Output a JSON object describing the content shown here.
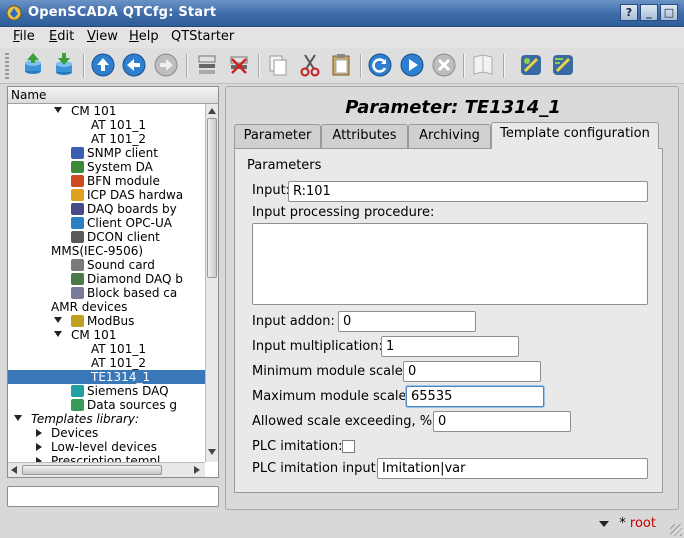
{
  "window": {
    "title": "OpenSCADA QTCfg: Start",
    "controls": [
      "?",
      "_",
      "□",
      "✕"
    ]
  },
  "menu": {
    "items": [
      {
        "label": "File",
        "mnemonic": "F",
        "rest": "ile"
      },
      {
        "label": "Edit",
        "mnemonic": "E",
        "rest": "dit"
      },
      {
        "label": "View",
        "mnemonic": "V",
        "rest": "iew"
      },
      {
        "label": "Help",
        "mnemonic": "H",
        "rest": "elp"
      },
      {
        "label": "QTStarter",
        "mnemonic": "",
        "rest": "QTStarter"
      }
    ]
  },
  "toolbar": {
    "icons": [
      "db-load-icon",
      "db-save-icon",
      "up-icon",
      "back-icon",
      "forward-icon",
      "add-icon",
      "delete-icon",
      "copy-icon",
      "cut-icon",
      "paste-icon",
      "reload-icon",
      "start-icon",
      "stop-icon",
      "manual-icon",
      "module-config-icon",
      "module-edit-icon"
    ]
  },
  "tree": {
    "header": "Name",
    "rows": [
      {
        "label": "CM 101",
        "indent": 3,
        "expander": "down",
        "icon": ""
      },
      {
        "label": "AT 101_1",
        "indent": 4,
        "expander": "",
        "icon": ""
      },
      {
        "label": "AT 101_2",
        "indent": 4,
        "expander": "",
        "icon": ""
      },
      {
        "label": "SNMP client",
        "indent": 3,
        "expander": "",
        "icon": "snmp-icon"
      },
      {
        "label": "System DA",
        "indent": 3,
        "expander": "",
        "icon": "system-icon"
      },
      {
        "label": "BFN module",
        "indent": 3,
        "expander": "",
        "icon": "bfn-icon"
      },
      {
        "label": "ICP DAS hardwa",
        "indent": 3,
        "expander": "",
        "icon": "icpdas-icon"
      },
      {
        "label": "DAQ boards by",
        "indent": 3,
        "expander": "",
        "icon": "daq-board-icon"
      },
      {
        "label": "Client OPC-UA",
        "indent": 3,
        "expander": "",
        "icon": "opc-icon"
      },
      {
        "label": "DCON client",
        "indent": 3,
        "expander": "",
        "icon": "dcon-icon"
      },
      {
        "label": "MMS(IEC-9506)",
        "indent": 2,
        "expander": "",
        "icon": ""
      },
      {
        "label": "Sound card",
        "indent": 3,
        "expander": "",
        "icon": "sound-icon"
      },
      {
        "label": "Diamond DAQ b",
        "indent": 3,
        "expander": "",
        "icon": "diamond-icon"
      },
      {
        "label": "Block based ca",
        "indent": 3,
        "expander": "",
        "icon": "block-icon"
      },
      {
        "label": "AMR devices",
        "indent": 2,
        "expander": "",
        "icon": ""
      },
      {
        "label": "ModBus",
        "indent": 3,
        "expander": "down",
        "icon": "modbus-icon"
      },
      {
        "label": "CM 101",
        "indent": 3,
        "expander": "down",
        "icon": ""
      },
      {
        "label": "AT 101_1",
        "indent": 4,
        "expander": "",
        "icon": ""
      },
      {
        "label": "AT 101_2",
        "indent": 4,
        "expander": "",
        "icon": ""
      },
      {
        "label": "TE1314_1",
        "indent": 4,
        "expander": "",
        "icon": "",
        "selected": true
      },
      {
        "label": "Siemens DAQ",
        "indent": 3,
        "expander": "",
        "icon": "siemens-icon"
      },
      {
        "label": "Data sources g",
        "indent": 3,
        "expander": "",
        "icon": "datasrc-icon"
      },
      {
        "label": "Templates library:",
        "indent": 1,
        "expander": "down",
        "icon": "",
        "italic": true
      },
      {
        "label": "Devices",
        "indent": 2,
        "expander": "right",
        "icon": ""
      },
      {
        "label": "Low-level devices",
        "indent": 2,
        "expander": "right",
        "icon": ""
      },
      {
        "label": "Prescription templ",
        "indent": 2,
        "expander": "right",
        "icon": ""
      }
    ]
  },
  "bottom_field": {
    "value": ""
  },
  "panel": {
    "title": "Parameter: TE1314_1",
    "tabs": [
      {
        "label": "Parameter",
        "active": false
      },
      {
        "label": "Attributes",
        "active": false
      },
      {
        "label": "Archiving",
        "active": false
      },
      {
        "label": "Template configuration",
        "active": true
      }
    ],
    "group_label": "Parameters",
    "fields": {
      "input": {
        "label": "Input:",
        "value": "R:101"
      },
      "procedure": {
        "label": "Input processing procedure:",
        "value": ""
      },
      "addon": {
        "label": "Input addon:",
        "value": "0"
      },
      "multiplication": {
        "label": "Input multiplication:",
        "value": "1"
      },
      "min_scale": {
        "label": "Minimum module scale:",
        "value": "0"
      },
      "max_scale": {
        "label": "Maximum module scale:",
        "value": "65535"
      },
      "exceeding": {
        "label": "Allowed scale exceeding, %:",
        "value": "0"
      },
      "plc_imitation": {
        "label": "PLC imitation:",
        "checked": false
      },
      "plc_input": {
        "label": "PLC imitation input:",
        "value": "Imitation|var"
      }
    }
  },
  "status": {
    "mark": "*",
    "user": "root"
  }
}
